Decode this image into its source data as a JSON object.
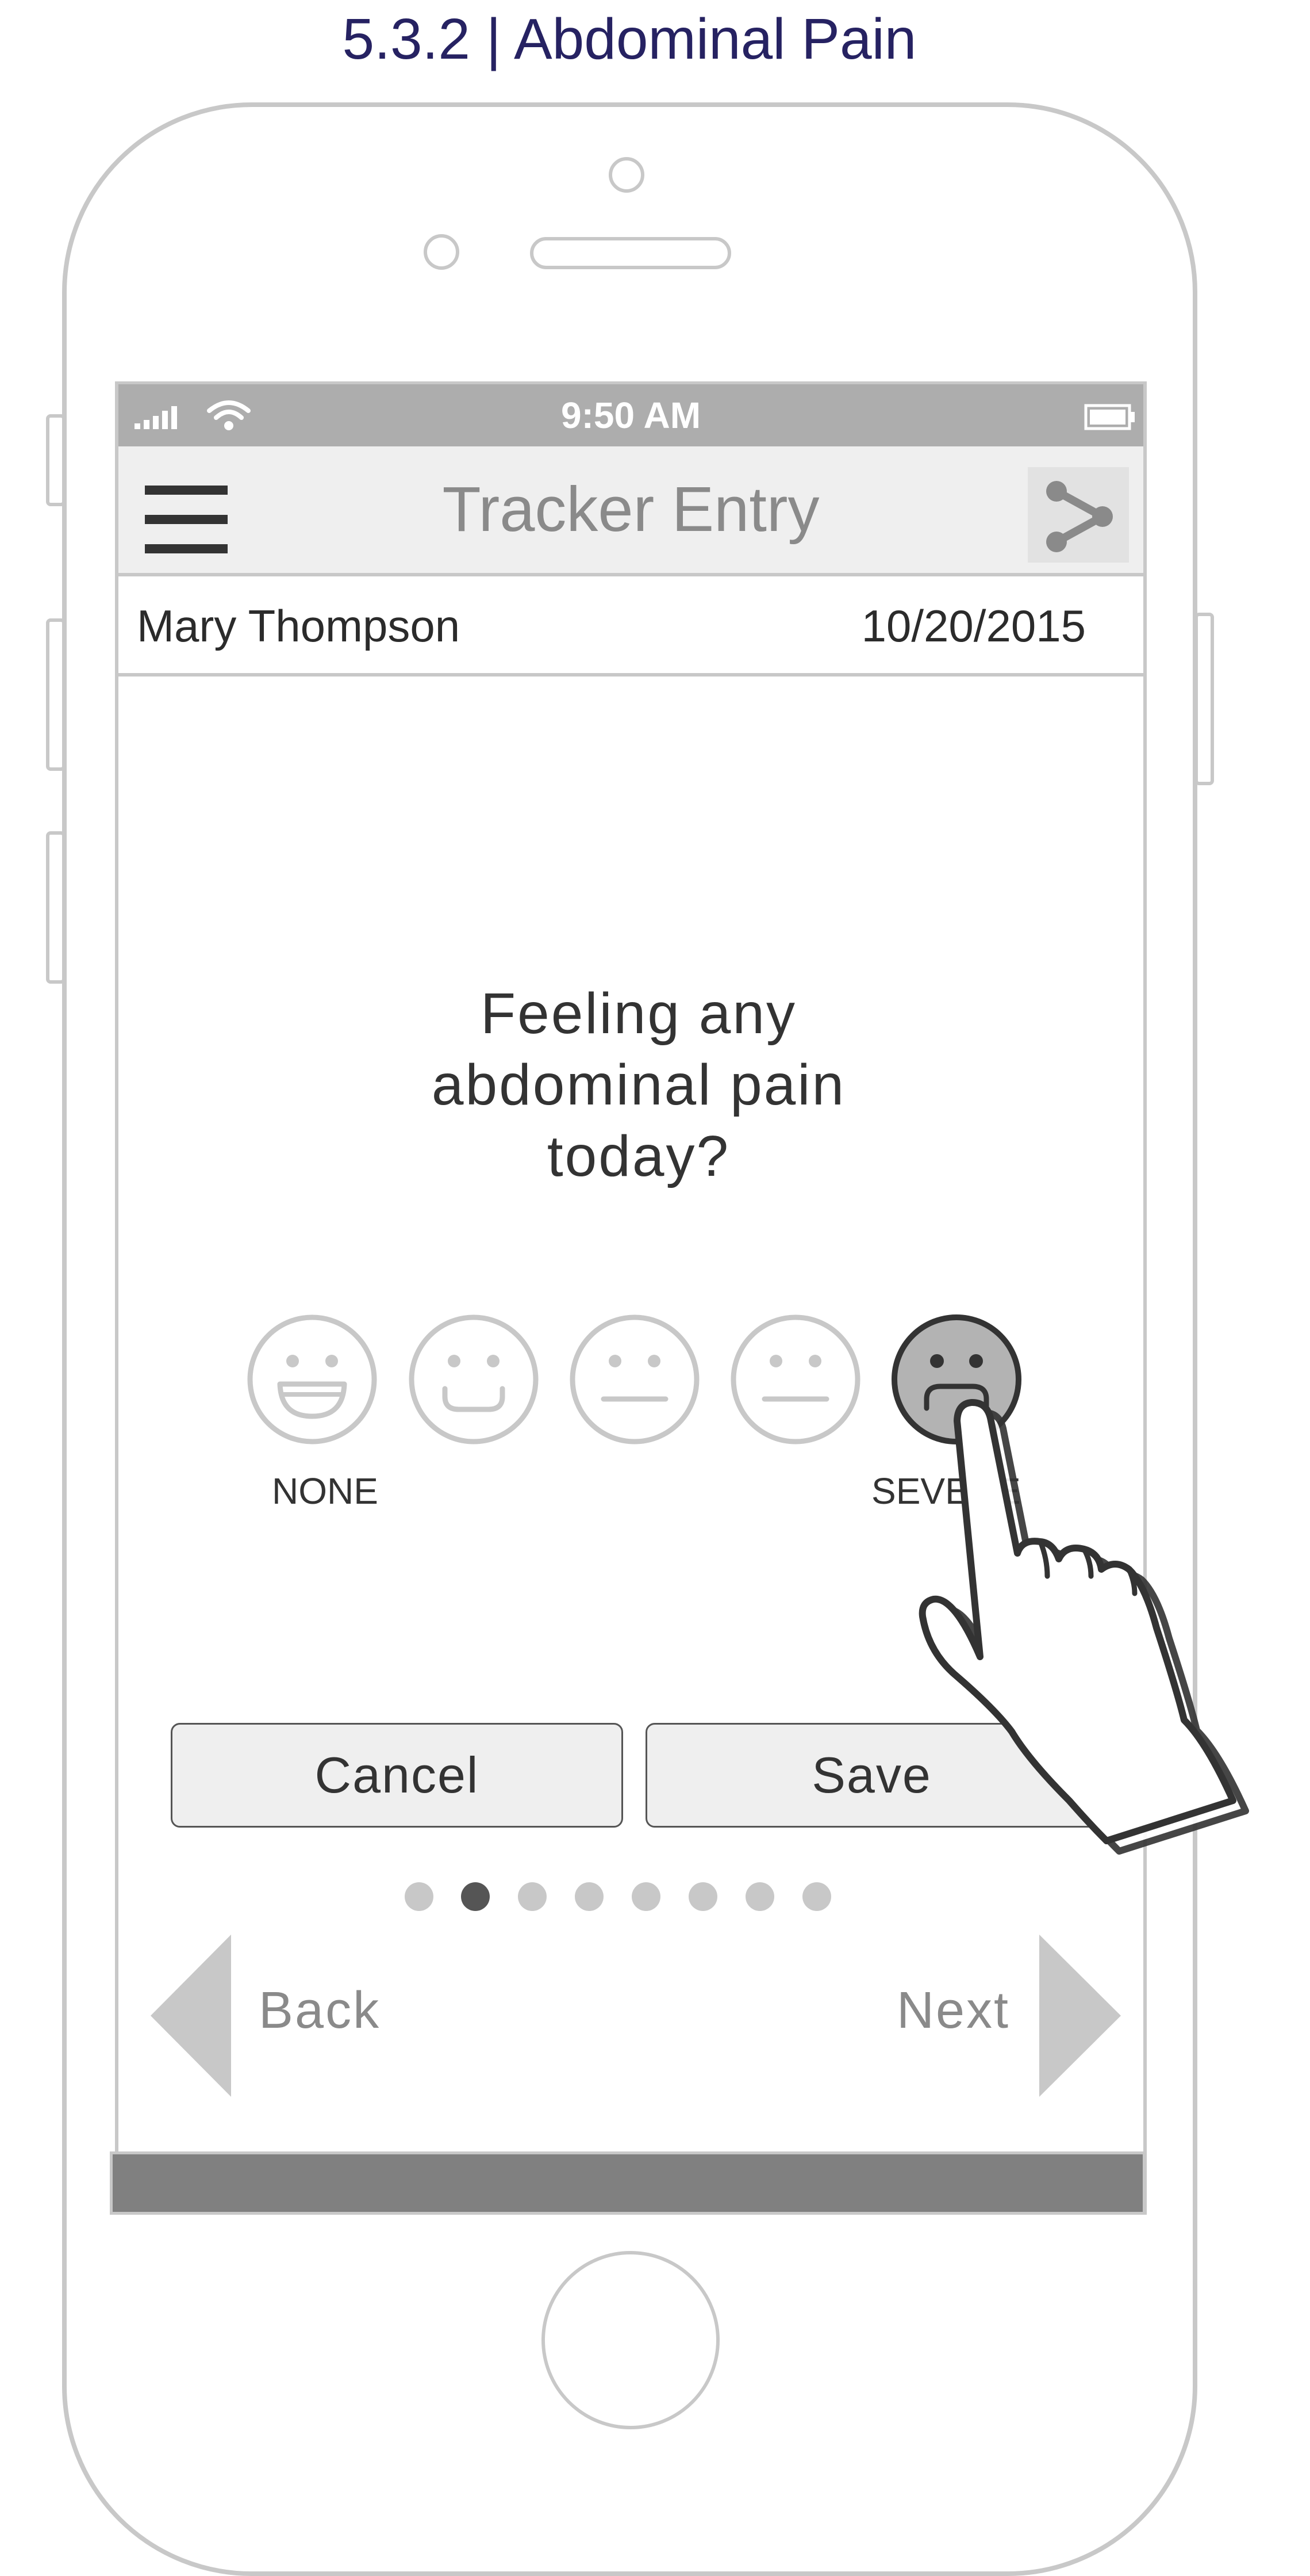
{
  "page": {
    "title": "5.3.2 | Abdominal Pain"
  },
  "status_bar": {
    "time": "9:50 AM",
    "signal_icon": "signal-bars-icon",
    "wifi_icon": "wifi-icon",
    "battery_icon": "battery-icon"
  },
  "nav": {
    "title": "Tracker Entry",
    "menu_icon": "hamburger-menu-icon",
    "share_icon": "share-icon"
  },
  "patient": {
    "name": "Mary Thompson",
    "date": "10/20/2015"
  },
  "question": {
    "lines": [
      "Feeling any",
      "abdominal pain",
      "today?"
    ]
  },
  "scale": {
    "faces": [
      "laughing-face-icon",
      "smiling-face-icon",
      "neutral-face-icon",
      "neutral-face-icon",
      "sad-face-icon"
    ],
    "selected_index": 4,
    "min_label": "NONE",
    "max_label": "SEVERE"
  },
  "buttons": {
    "cancel": "Cancel",
    "save": "Save"
  },
  "pager": {
    "total": 8,
    "current": 2
  },
  "navigation": {
    "back": "Back",
    "next": "Next"
  },
  "colors": {
    "title": "#262262",
    "frame": "#c8c8c8",
    "statusbar": "#adadad",
    "active_dot": "#555555"
  }
}
